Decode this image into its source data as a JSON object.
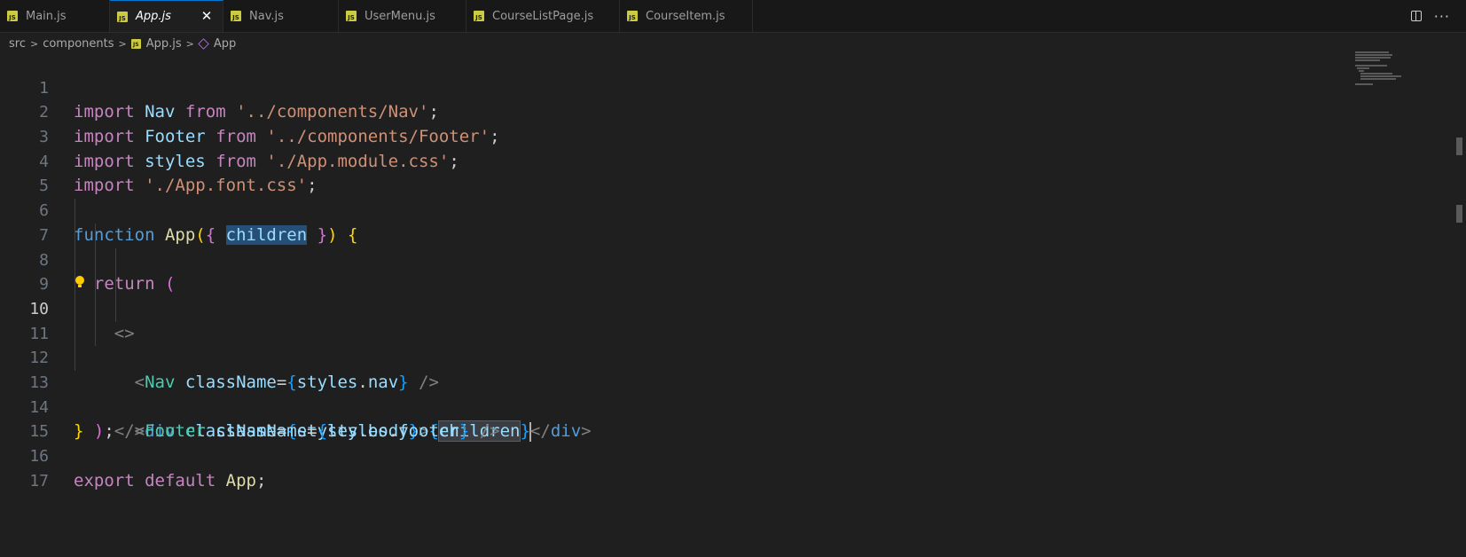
{
  "tabs": [
    {
      "label": "Main.js",
      "icon": "js-file-icon",
      "active": false
    },
    {
      "label": "App.js",
      "icon": "js-file-icon",
      "active": true
    },
    {
      "label": "Nav.js",
      "icon": "js-file-icon",
      "active": false
    },
    {
      "label": "UserMenu.js",
      "icon": "js-file-icon",
      "active": false
    },
    {
      "label": "CourseListPage.js",
      "icon": "js-file-icon",
      "active": false
    },
    {
      "label": "CourseItem.js",
      "icon": "js-file-icon",
      "active": false
    }
  ],
  "js_icon_text": "JS",
  "close_glyph": "✕",
  "more_glyph": "···",
  "breadcrumb": {
    "items": [
      "src",
      "components",
      "App.js",
      "App"
    ],
    "separator": ">"
  },
  "editor": {
    "current_line": 10,
    "line_numbers": [
      "1",
      "2",
      "3",
      "4",
      "5",
      "6",
      "7",
      "8",
      "9",
      "10",
      "11",
      "12",
      "13",
      "14",
      "15",
      "16",
      "17"
    ]
  },
  "colors": {
    "active_tab_border": "#0078d4",
    "js_icon": "#cbcb41",
    "background": "#1f1f1f",
    "selection": "#264f78",
    "lightbulb": "#ffcc00"
  }
}
